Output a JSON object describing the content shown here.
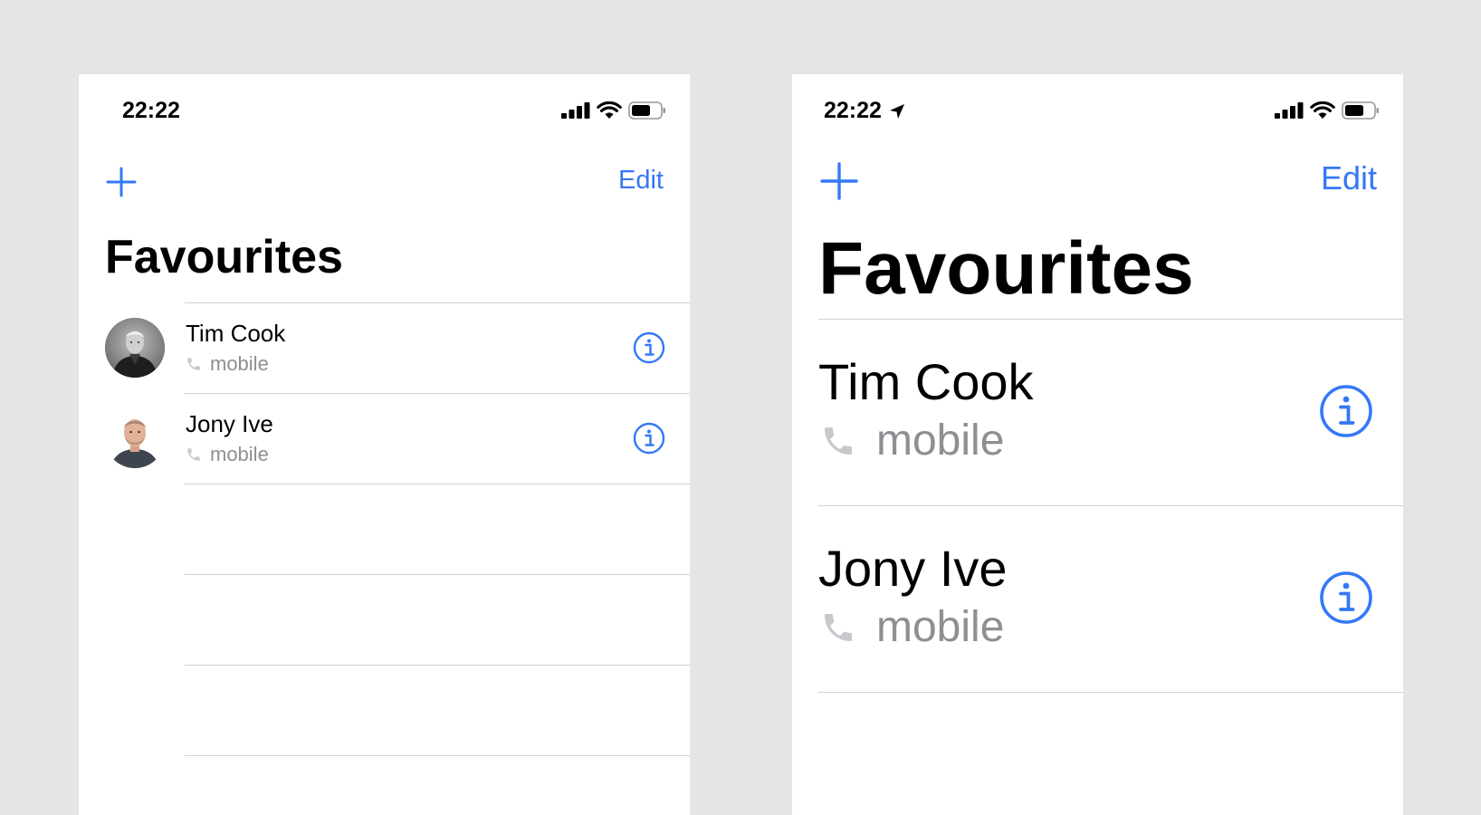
{
  "left": {
    "status": {
      "time": "22:22"
    },
    "nav": {
      "add_icon": "plus-icon",
      "edit_label": "Edit"
    },
    "title": "Favourites",
    "contacts": [
      {
        "name": "Tim Cook",
        "label": "mobile",
        "avatar": "avatar-photo"
      },
      {
        "name": "Jony Ive",
        "label": "mobile",
        "avatar": "avatar-photo"
      }
    ]
  },
  "right": {
    "status": {
      "time": "22:22"
    },
    "nav": {
      "add_icon": "plus-icon",
      "edit_label": "Edit"
    },
    "title": "Favourites",
    "contacts": [
      {
        "name": "Tim Cook",
        "label": "mobile"
      },
      {
        "name": "Jony Ive",
        "label": "mobile"
      }
    ]
  },
  "colors": {
    "accent": "#3478f6",
    "secondary": "#8e8e93",
    "separator": "#d1d1d6",
    "background": "#e5e5e5"
  }
}
